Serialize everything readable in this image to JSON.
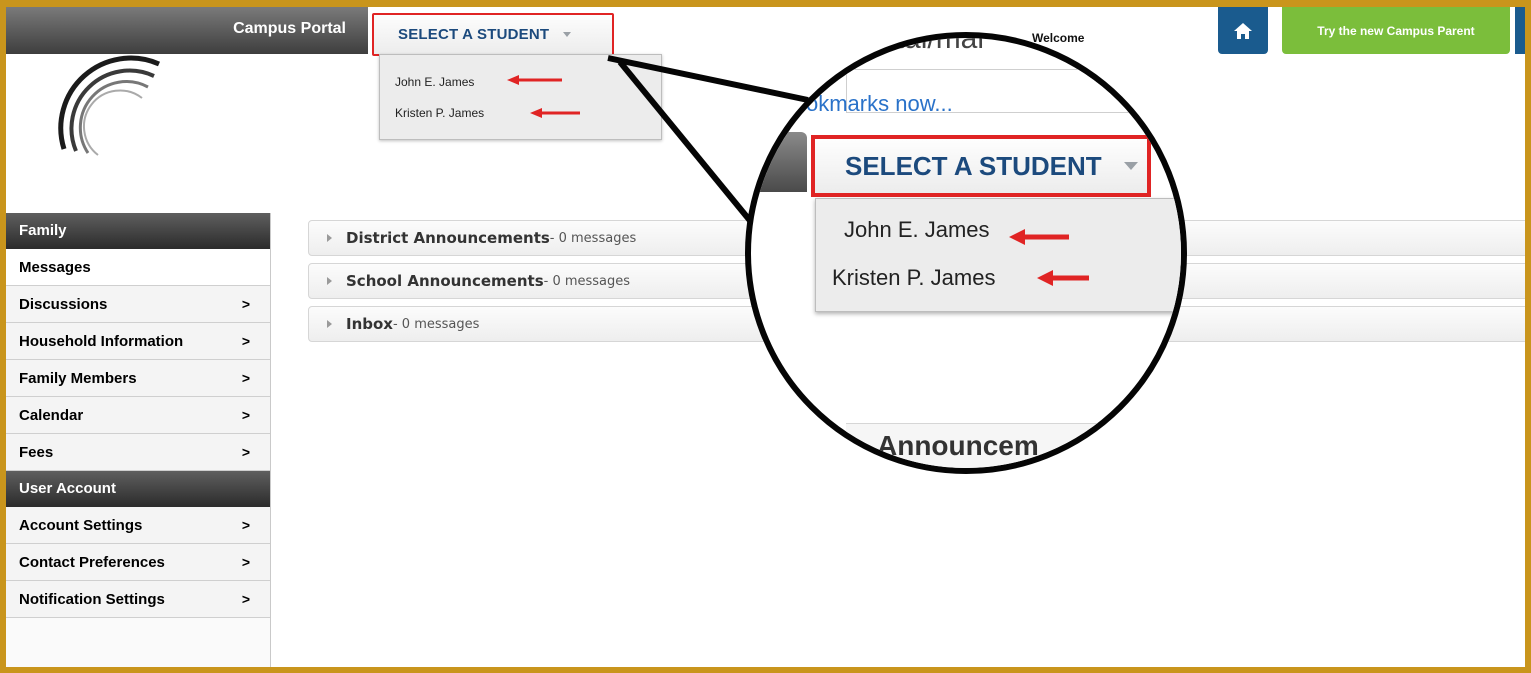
{
  "header": {
    "app_title": "Campus Portal",
    "select_student": {
      "label": "SELECT A STUDENT",
      "options": [
        "John E. James",
        "Kristen P. James"
      ]
    },
    "welcome": "Welcome",
    "home_icon": "home-icon",
    "try_parent_button": "Try the new Campus Parent"
  },
  "sidebar": {
    "sections": [
      {
        "heading": "Family",
        "items": [
          {
            "label": "Messages",
            "chevron": ""
          },
          {
            "label": "Discussions",
            "chevron": ">"
          },
          {
            "label": "Household Information",
            "chevron": ">"
          },
          {
            "label": "Family Members",
            "chevron": ">"
          },
          {
            "label": "Calendar",
            "chevron": ">"
          },
          {
            "label": "Fees",
            "chevron": ">"
          }
        ]
      },
      {
        "heading": "User Account",
        "items": [
          {
            "label": "Account Settings",
            "chevron": ">"
          },
          {
            "label": "Contact Preferences",
            "chevron": ">"
          },
          {
            "label": "Notification Settings",
            "chevron": ">"
          }
        ]
      }
    ]
  },
  "main": {
    "announcements": [
      {
        "name": "District Announcements",
        "count": " - 0 messages"
      },
      {
        "name": "School Announcements",
        "count": " - 0 messages"
      },
      {
        "name": "Inbox",
        "count": " - 0 messages"
      }
    ]
  },
  "magnifier": {
    "url_text": "ortal/mai",
    "bookmarks_text": "okmarks now...",
    "select_label": "SELECT A STUDENT",
    "options": [
      "John E. James",
      "Kristen P. James"
    ],
    "lower_text": "Announcem"
  },
  "colors": {
    "frame": "#c9951c",
    "highlight": "#e02424",
    "brand_blue": "#1a5b8e",
    "parent_green": "#7bbe3b"
  }
}
